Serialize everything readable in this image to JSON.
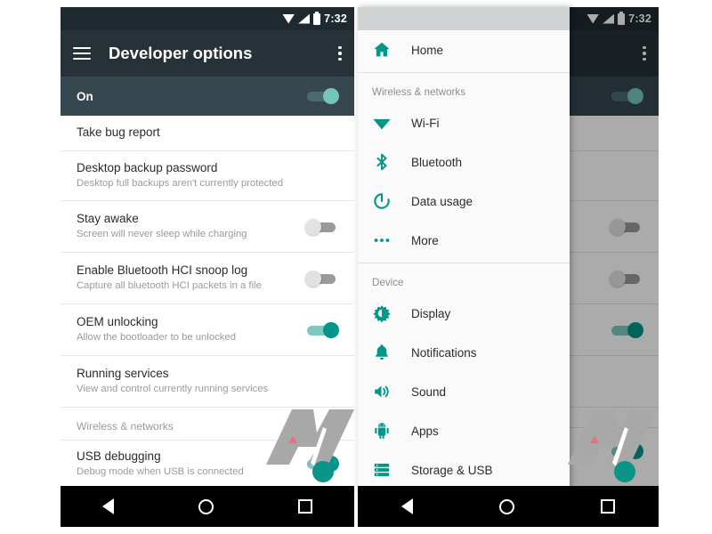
{
  "status_bar": {
    "time": "7:32",
    "icons": [
      "wifi-icon",
      "signal-icon",
      "battery-icon"
    ]
  },
  "colors": {
    "toolbar_bg": "#263238",
    "statusbar_bg": "#1f2a30",
    "accent_teal": "#009688",
    "on_row_bg": "#37474f",
    "navbar_bg": "#000000",
    "drawer_bg": "#fafafa"
  },
  "toolbar": {
    "menu_icon": "hamburger-icon",
    "title": "Developer options",
    "overflow_icon": "overflow-menu-icon"
  },
  "master_switch": {
    "label": "On",
    "state": "on"
  },
  "settings_list": [
    {
      "title": "Take bug report",
      "sub": "",
      "toggle": "none"
    },
    {
      "title": "Desktop backup password",
      "sub": "Desktop full backups aren't currently protected",
      "toggle": "none"
    },
    {
      "title": "Stay awake",
      "sub": "Screen will never sleep while charging",
      "toggle": "off"
    },
    {
      "title": "Enable Bluetooth HCI snoop log",
      "sub": "Capture all bluetooth HCI packets in a file",
      "toggle": "off"
    },
    {
      "title": "OEM unlocking",
      "sub": "Allow the bootloader to be unlocked",
      "toggle": "on"
    },
    {
      "title": "Running services",
      "sub": "View and control currently running services",
      "toggle": "none"
    }
  ],
  "settings_section_header": "Wireless & networks",
  "settings_last_row": {
    "title": "USB debugging",
    "sub": "Debug mode when USB is connected",
    "toggle": "on"
  },
  "drawer": {
    "home": {
      "label": "Home",
      "icon": "home-icon"
    },
    "section_wireless": "Wireless & networks",
    "wireless_items": [
      {
        "label": "Wi-Fi",
        "icon": "wifi-icon"
      },
      {
        "label": "Bluetooth",
        "icon": "bluetooth-icon"
      },
      {
        "label": "Data usage",
        "icon": "data-usage-icon"
      },
      {
        "label": "More",
        "icon": "more-icon"
      }
    ],
    "section_device": "Device",
    "device_items": [
      {
        "label": "Display",
        "icon": "display-icon"
      },
      {
        "label": "Notifications",
        "icon": "notifications-bell-icon"
      },
      {
        "label": "Sound",
        "icon": "sound-speaker-icon"
      },
      {
        "label": "Apps",
        "icon": "apps-android-icon"
      },
      {
        "label": "Storage & USB",
        "icon": "storage-icon"
      }
    ]
  },
  "nav_bar": {
    "back": "back-icon",
    "home": "home-circle-icon",
    "recents": "recents-square-icon"
  }
}
